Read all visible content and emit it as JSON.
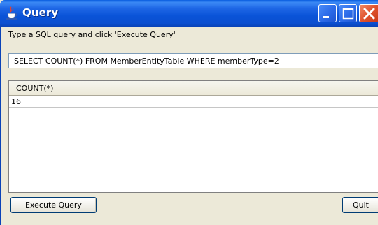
{
  "window": {
    "title": "Query",
    "icon": "java-coffee-cup-icon",
    "controls": [
      "minimize-icon",
      "maximize-icon",
      "close-icon"
    ]
  },
  "instruction": "Type a SQL query and click 'Execute Query'",
  "query": {
    "value": "SELECT COUNT(*) FROM MemberEntityTable WHERE memberType=2"
  },
  "results": {
    "columns": [
      "COUNT(*)"
    ],
    "rows": [
      [
        "16"
      ]
    ]
  },
  "buttons": {
    "execute": "Execute Query",
    "quit": "Quit"
  },
  "colors": {
    "titlebar": "#0A53D8",
    "close_button": "#E0532F",
    "window_background": "#ECE9D8"
  }
}
